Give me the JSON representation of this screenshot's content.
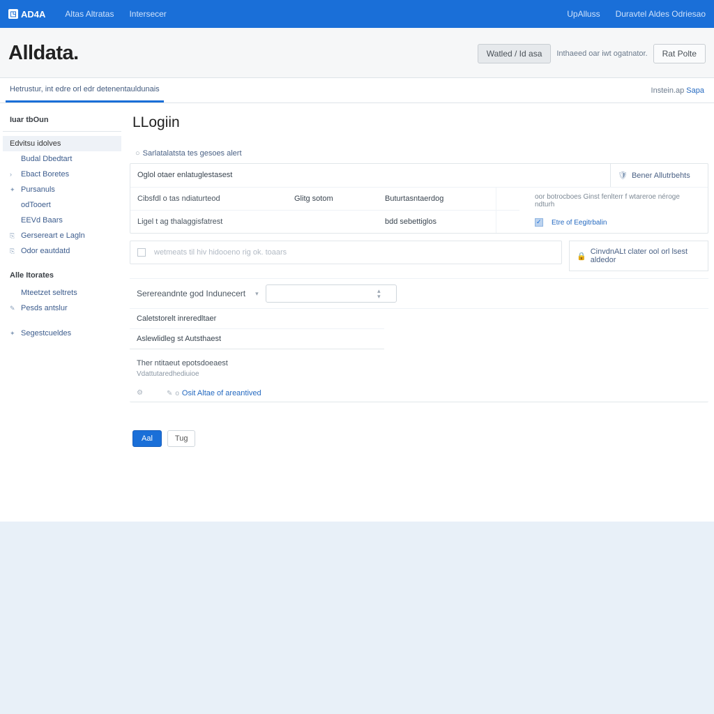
{
  "topbar": {
    "brand_short": "AD4A",
    "nav": [
      "Altas Altratas",
      "Intersecer"
    ],
    "right": [
      "UpAlluss",
      "Duravtel Aldes Odriesao"
    ]
  },
  "header": {
    "logo": "Alldata.",
    "btn_primary": "Watled / Id asa",
    "btn_text": "Inthaeed oar iwt ogatnator.",
    "btn_secondary": "Rat Polte"
  },
  "tabbar": {
    "active": "Hetrustur, int edre orl edr detenentauldunais",
    "crumb_text": "Instein.ap ",
    "crumb_link": "Sapa"
  },
  "sidebar": {
    "title": "Iuar tbOun",
    "group1": "Edvitsu idolves",
    "items1": [
      {
        "label": "Budal Dbedtart",
        "icon": ""
      },
      {
        "label": "Ebact Boretes",
        "icon": "›"
      },
      {
        "label": "Pursanuls",
        "icon": "✦"
      },
      {
        "label": "odTooert",
        "icon": ""
      },
      {
        "label": "EEVd Baars",
        "icon": ""
      },
      {
        "label": "Gersereart e Lagln",
        "icon": "⎘"
      },
      {
        "label": "Odor eautdatd",
        "icon": "⎘"
      }
    ],
    "group2": "Alle Itorates",
    "items2": [
      {
        "label": "Mteetzet seltrets",
        "icon": ""
      },
      {
        "label": "Pesds antslur",
        "icon": "✎"
      }
    ],
    "items3": [
      {
        "label": "Segestcueldes",
        "icon": "✦"
      }
    ]
  },
  "page": {
    "title": "LLogiin",
    "panel1_hd": "Sarlatalatsta tes gesoes alert",
    "row1_label": "Oglol otaer enlatuglestasest",
    "row1_right": "Bener Allutrbehts",
    "row2_c1": "Cibsfdl o tas ndiaturteod",
    "row2_c2": "Glitg sotom",
    "row2_c3": "Buturtasntaerdog",
    "row2_note": "oor botrocboes Ginst fenlterr f wtareroe néroge ndturh",
    "row3_c1": "Ligel t ag thalaggisfatrest",
    "row3_c3": "bdd sebettiglos",
    "row3_chk": "Etre of Eegitrbalin",
    "info_line": "wetmeats til hiv hidooeno rig ok. toaars",
    "panel3_right": "CinvdnALt clater ool orl lsest aldedor",
    "select_label": "Serereandnte god Indunecert",
    "row_c": "Caletstorelt inreredltaer",
    "row_d": "Aslewlidleg st Autsthaest",
    "block_title": "Ther ntitaeut epotsdoeaest",
    "block_sub": "Vdattutaredhediuioe",
    "link1_ic": "⚙",
    "link1_txt": "",
    "link2_ic": "✎",
    "link2_dot": "o",
    "link2_txt": "Osit Altae of areantived",
    "btn_save": "Aal",
    "btn_cancel": "Tug"
  }
}
